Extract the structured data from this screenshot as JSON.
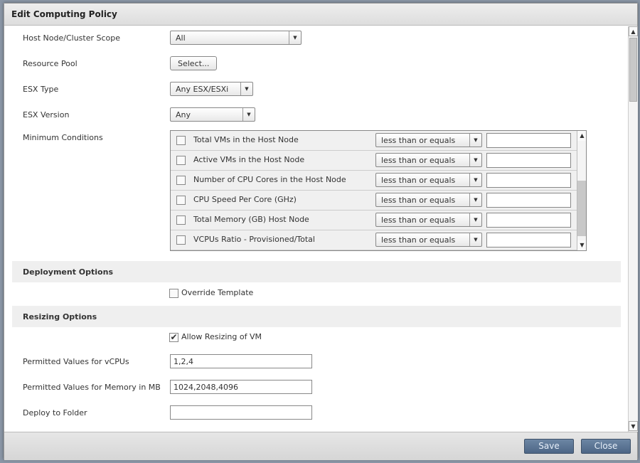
{
  "dialog": {
    "title": "Edit Computing Policy"
  },
  "fields": {
    "scope": {
      "label": "Host Node/Cluster Scope",
      "value": "All"
    },
    "resource_pool": {
      "label": "Resource Pool",
      "button": "Select..."
    },
    "esx_type": {
      "label": "ESX Type",
      "value": "Any ESX/ESXi"
    },
    "esx_version": {
      "label": "ESX Version",
      "value": "Any"
    },
    "min_conditions": {
      "label": "Minimum Conditions"
    }
  },
  "conditions": [
    {
      "name": "Total VMs in the Host Node",
      "operator": "less than or equals",
      "value": "",
      "checked": false
    },
    {
      "name": "Active VMs in the Host Node",
      "operator": "less than or equals",
      "value": "",
      "checked": false
    },
    {
      "name": "Number of CPU Cores in the Host Node",
      "operator": "less than or equals",
      "value": "",
      "checked": false
    },
    {
      "name": "CPU Speed Per Core (GHz)",
      "operator": "less than or equals",
      "value": "",
      "checked": false
    },
    {
      "name": "Total Memory (GB) Host Node",
      "operator": "less than or equals",
      "value": "",
      "checked": false
    },
    {
      "name": "VCPUs Ratio - Provisioned/Total",
      "operator": "less than or equals",
      "value": "",
      "checked": false
    }
  ],
  "deployment": {
    "title": "Deployment Options",
    "override_template": {
      "label": "Override Template",
      "checked": false
    }
  },
  "resizing": {
    "title": "Resizing Options",
    "allow_resizing": {
      "label": "Allow Resizing of VM",
      "checked": true
    },
    "vcpus": {
      "label": "Permitted Values for vCPUs",
      "value": "1,2,4"
    },
    "memory": {
      "label": "Permitted Values for Memory in MB",
      "value": "1024,2048,4096"
    },
    "folder": {
      "label": "Deploy to Folder",
      "value": ""
    }
  },
  "footer": {
    "save": "Save",
    "close": "Close"
  }
}
